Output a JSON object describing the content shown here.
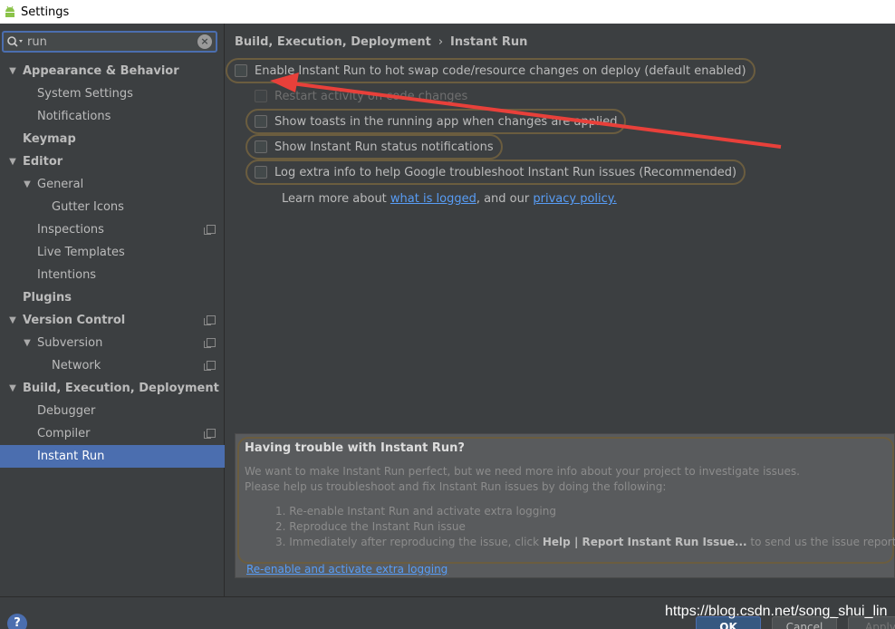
{
  "window": {
    "title": "Settings"
  },
  "search": {
    "value": "run"
  },
  "sidebar": {
    "items": [
      {
        "label": "Appearance & Behavior",
        "level": 0,
        "arrow": true,
        "bold": true,
        "copy": false
      },
      {
        "label": "System Settings",
        "level": 1,
        "arrow": false,
        "bold": false,
        "copy": false
      },
      {
        "label": "Notifications",
        "level": 1,
        "arrow": false,
        "bold": false,
        "copy": false
      },
      {
        "label": "Keymap",
        "level": 0,
        "arrow": false,
        "bold": true,
        "copy": false
      },
      {
        "label": "Editor",
        "level": 0,
        "arrow": true,
        "bold": true,
        "copy": false
      },
      {
        "label": "General",
        "level": 1,
        "arrow": true,
        "bold": false,
        "copy": false
      },
      {
        "label": "Gutter Icons",
        "level": 2,
        "arrow": false,
        "bold": false,
        "copy": false
      },
      {
        "label": "Inspections",
        "level": 1,
        "arrow": false,
        "bold": false,
        "copy": true
      },
      {
        "label": "Live Templates",
        "level": 1,
        "arrow": false,
        "bold": false,
        "copy": false
      },
      {
        "label": "Intentions",
        "level": 1,
        "arrow": false,
        "bold": false,
        "copy": false
      },
      {
        "label": "Plugins",
        "level": 0,
        "arrow": false,
        "bold": true,
        "copy": false
      },
      {
        "label": "Version Control",
        "level": 0,
        "arrow": true,
        "bold": true,
        "copy": true
      },
      {
        "label": "Subversion",
        "level": 1,
        "arrow": true,
        "bold": false,
        "copy": true
      },
      {
        "label": "Network",
        "level": 2,
        "arrow": false,
        "bold": false,
        "copy": true
      },
      {
        "label": "Build, Execution, Deployment",
        "level": 0,
        "arrow": true,
        "bold": true,
        "copy": false
      },
      {
        "label": "Debugger",
        "level": 1,
        "arrow": false,
        "bold": false,
        "copy": false
      },
      {
        "label": "Compiler",
        "level": 1,
        "arrow": false,
        "bold": false,
        "copy": true
      },
      {
        "label": "Instant Run",
        "level": 1,
        "arrow": false,
        "bold": false,
        "copy": false,
        "selected": true
      }
    ]
  },
  "breadcrumb": {
    "parent": "Build, Execution, Deployment",
    "separator": "›",
    "current": "Instant Run"
  },
  "options": {
    "enable": "Enable Instant Run to hot swap code/resource changes on deploy (default enabled)",
    "restart": "Restart activity on code changes",
    "toasts": "Show toasts in the running app when changes are applied",
    "status": "Show Instant Run status notifications",
    "log": "Log extra info to help Google troubleshoot Instant Run issues (Recommended)"
  },
  "learn_more": {
    "prefix": "Learn more about ",
    "link1": "what is logged",
    "middle": ", and our ",
    "link2": "privacy policy."
  },
  "trouble": {
    "title": "Having trouble with Instant Run?",
    "line1": "We want to make Instant Run perfect, but we need more info about your project to investigate issues.",
    "line2": "Please help us troubleshoot and fix Instant Run issues by doing the following:",
    "step1": "1. Re-enable Instant Run and activate extra logging",
    "step2": "2. Reproduce the Instant Run issue",
    "step3_prefix": "3. Immediately after reproducing the issue, click ",
    "step3_bold": "Help | Report Instant Run Issue...",
    "step3_suffix": " to send us the issue report.",
    "link": "Re-enable and activate extra logging"
  },
  "footer": {
    "help": "?",
    "watermark": "https://blog.csdn.net/song_shui_lin",
    "ok": "OK",
    "cancel": "Cancel",
    "apply": "Apply"
  },
  "colors": {
    "accent": "#4b6eaf",
    "highlight_border": "#6b5d3f",
    "annotation_arrow": "#e8403a",
    "link": "#589df6"
  }
}
